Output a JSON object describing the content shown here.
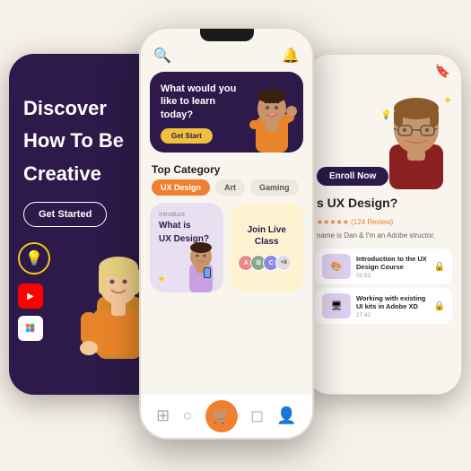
{
  "scene": {
    "background": "#f5f0e8"
  },
  "left_phone": {
    "heading_line1": "Discover",
    "heading_line2": "How To Be",
    "heading_line3": "Creative",
    "get_started_label": "Get Started"
  },
  "center_phone": {
    "banner": {
      "title_line1": "What would you",
      "title_line2": "like to learn",
      "title_line3": "today?",
      "cta_label": "Get Start"
    },
    "top_category_label": "Top Category",
    "categories": [
      {
        "label": "UX Design",
        "active": true
      },
      {
        "label": "Art",
        "active": false
      },
      {
        "label": "Gaming",
        "active": false
      }
    ],
    "introduce_card": {
      "label": "Introduce",
      "title_line1": "What is",
      "title_line2": "UX Design?"
    },
    "live_card": {
      "title_line1": "Join Live",
      "title_line2": "Class",
      "count": "+8"
    },
    "bottom_nav": {
      "icons": [
        "⊞",
        "○",
        "🛍",
        "◻",
        "👤"
      ]
    }
  },
  "right_phone": {
    "enroll_label": "Enroll Now",
    "question": "s UX Design?",
    "rating": "★★★★★ (124 Review)",
    "instructor_text": "name is Dan & I'm an Adobe structor.",
    "courses": [
      {
        "name": "Introduction to the UX Design Course",
        "duration": "02:53"
      },
      {
        "name": "Working with existing UI kits in Adobe XD",
        "duration": "17:42"
      }
    ]
  }
}
